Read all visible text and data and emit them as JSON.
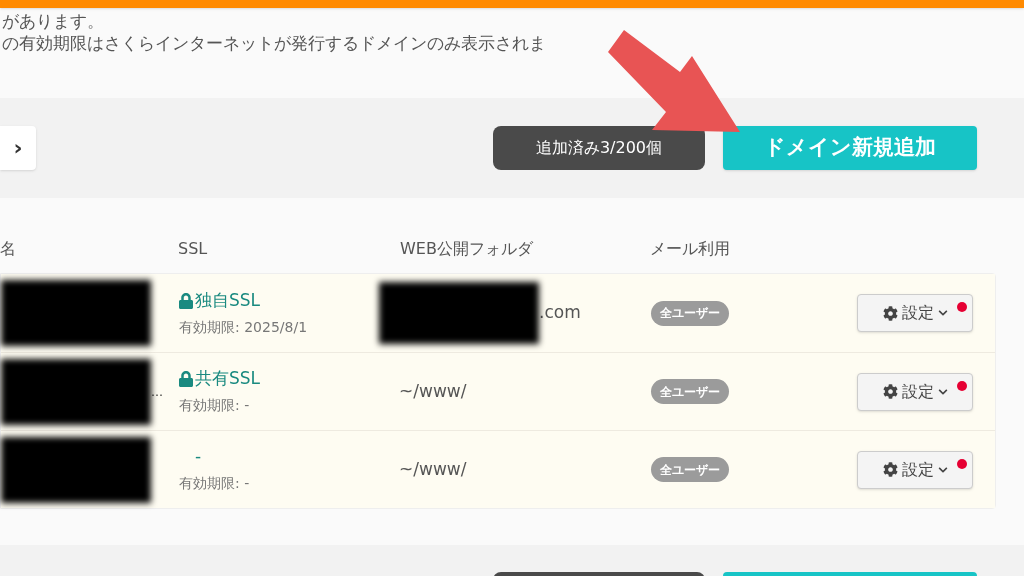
{
  "notice_lines": [
    "があります。",
    "の有効期限はさくらインターネットが発行するドメインのみ表示されま"
  ],
  "toolbar": {
    "next_button": "›",
    "counter": "追加済み3/200個",
    "add_button": "ドメイン新規追加"
  },
  "table": {
    "columns": [
      "名",
      "SSL",
      "WEB公開フォルダ",
      "メール利用"
    ],
    "rows": [
      {
        "ssl": {
          "label": "独自SSL",
          "locked": true
        },
        "expiry": "有効期限: 2025/8/1",
        "folder": ".com",
        "folder_redacted": true,
        "name_trail": "",
        "mail": "全ユーザー",
        "settings": "設定",
        "alert": true
      },
      {
        "ssl": {
          "label": "共有SSL",
          "locked": true
        },
        "expiry": "有効期限: -",
        "folder": "~/www/",
        "folder_redacted": false,
        "name_trail": "…",
        "mail": "全ユーザー",
        "settings": "設定",
        "alert": true
      },
      {
        "ssl": {
          "label": "-",
          "locked": false
        },
        "expiry": "有効期限: -",
        "folder": "~/www/",
        "folder_redacted": false,
        "name_trail": "",
        "mail": "全ユーザー",
        "settings": "設定",
        "alert": true
      }
    ]
  }
}
